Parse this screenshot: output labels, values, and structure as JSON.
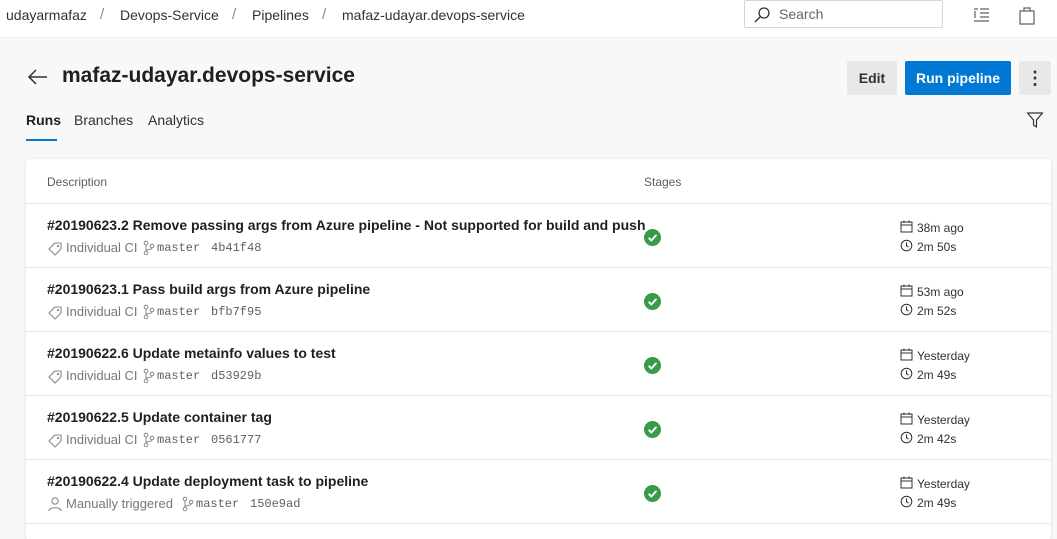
{
  "breadcrumb": {
    "items": [
      "udayarmafaz",
      "Devops-Service",
      "Pipelines",
      "mafaz-udayar.devops-service"
    ],
    "separator": "/"
  },
  "search": {
    "placeholder": "Search"
  },
  "header": {
    "title": "mafaz-udayar.devops-service",
    "edit_label": "Edit",
    "run_label": "Run pipeline",
    "more_label": "⋮"
  },
  "tabs": [
    {
      "label": "Runs",
      "active": true
    },
    {
      "label": "Branches",
      "active": false
    },
    {
      "label": "Analytics",
      "active": false
    }
  ],
  "table": {
    "columns": {
      "description": "Description",
      "stages": "Stages"
    },
    "runs": [
      {
        "title": "#20190623.2 Remove passing args from Azure pipeline - Not supported for build and push",
        "trigger": "Individual CI",
        "trigger_icon": "tag-icon",
        "branch": "master",
        "commit": "4b41f48",
        "status": "succeeded",
        "when": "38m ago",
        "duration": "2m 50s"
      },
      {
        "title": "#20190623.1 Pass build args from Azure pipeline",
        "trigger": "Individual CI",
        "trigger_icon": "tag-icon",
        "branch": "master",
        "commit": "bfb7f95",
        "status": "succeeded",
        "when": "53m ago",
        "duration": "2m 52s"
      },
      {
        "title": "#20190622.6 Update metainfo values to test",
        "trigger": "Individual CI",
        "trigger_icon": "tag-icon",
        "branch": "master",
        "commit": "d53929b",
        "status": "succeeded",
        "when": "Yesterday",
        "duration": "2m 49s"
      },
      {
        "title": "#20190622.5 Update container tag",
        "trigger": "Individual CI",
        "trigger_icon": "tag-icon",
        "branch": "master",
        "commit": "0561777",
        "status": "succeeded",
        "when": "Yesterday",
        "duration": "2m 42s"
      },
      {
        "title": "#20190622.4 Update deployment task to pipeline",
        "trigger": "Manually triggered",
        "trigger_icon": "person-icon",
        "branch": "master",
        "commit": "150e9ad",
        "status": "succeeded",
        "when": "Yesterday",
        "duration": "2m 49s"
      }
    ]
  },
  "colors": {
    "accent": "#0078d4",
    "success": "#3a9a49",
    "text": "#323130",
    "muted": "#797775"
  }
}
